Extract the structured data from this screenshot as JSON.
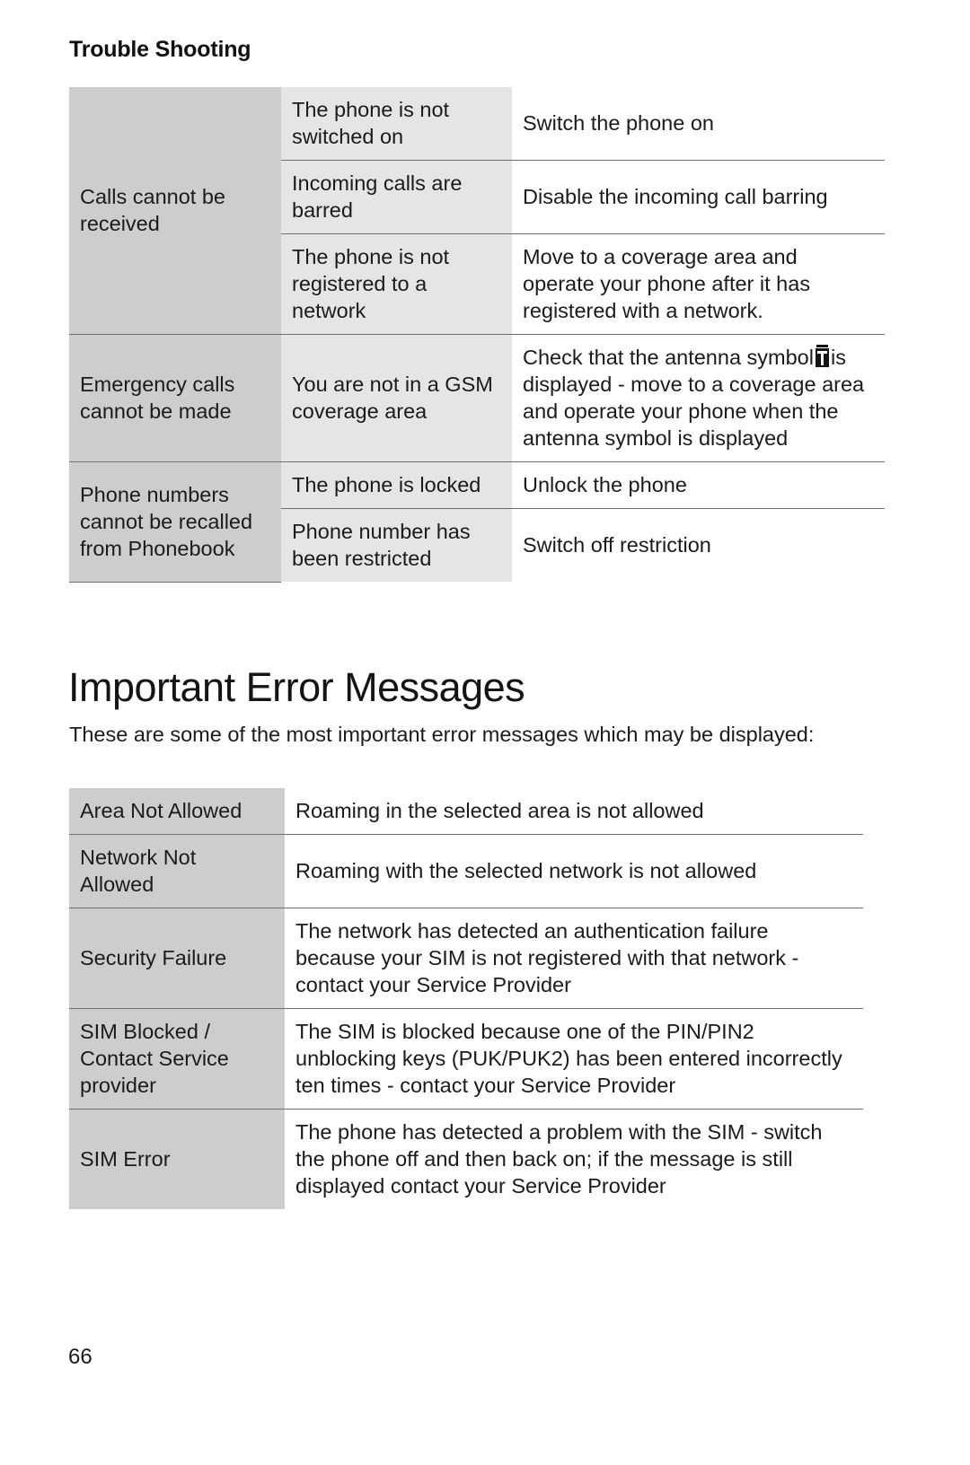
{
  "page": {
    "section_title": "Trouble Shooting",
    "chapter_title": "Important Error Messages",
    "intro_paragraph": "These are some of the most important error messages which may be displayed:",
    "page_number": "66"
  },
  "trouble_shooting_table": {
    "groups": [
      {
        "problem": "Calls cannot be received",
        "rows": [
          {
            "cause": "The phone is not switched on",
            "solution": "Switch the phone on"
          },
          {
            "cause": "Incoming calls are barred",
            "solution": "Disable the incoming call barring"
          },
          {
            "cause": "The phone is not registered to a network",
            "solution": "Move to a coverage area and operate your phone after it has registered with a network."
          }
        ]
      },
      {
        "problem": "Emergency calls cannot be made",
        "rows": [
          {
            "cause": "You are not in a GSM coverage area",
            "solution_before_icon": "Check that the antenna symbol",
            "solution_icon": "antenna-symbol-icon",
            "solution_after_icon": "is displayed - move to a coverage area and operate your phone when the antenna symbol is displayed"
          }
        ]
      },
      {
        "problem": "Phone numbers cannot be recalled from Phonebook",
        "rows": [
          {
            "cause": "The phone is locked",
            "solution": "Unlock the phone"
          },
          {
            "cause": "Phone number has been restricted",
            "solution": "Switch off restriction"
          }
        ]
      }
    ]
  },
  "error_messages_table": {
    "rows": [
      {
        "message": "Area Not Allowed",
        "description": "Roaming in the selected area is not allowed"
      },
      {
        "message": "Network Not Allowed",
        "description": "Roaming with the selected network is not allowed"
      },
      {
        "message": "Security Failure",
        "description": "The network has detected an authentication failure because your SIM is not registered with that network - contact your Service Provider"
      },
      {
        "message": "SIM Blocked / Contact Service provider",
        "description": "The SIM is blocked because one of the PIN/PIN2 unblocking keys (PUK/PUK2) has been entered incorrectly ten times - contact your Service Provider"
      },
      {
        "message": "SIM Error",
        "description": "The phone has detected a problem with the SIM - switch the phone off and then back on; if the message is still displayed contact your Service Provider"
      }
    ]
  },
  "colors": {
    "column1_background": "#cdcdcd",
    "column2_background": "#e5e5e5",
    "column3_background": "#ffffff",
    "text": "#1b1b1b",
    "rule": "#6f6f6f"
  }
}
